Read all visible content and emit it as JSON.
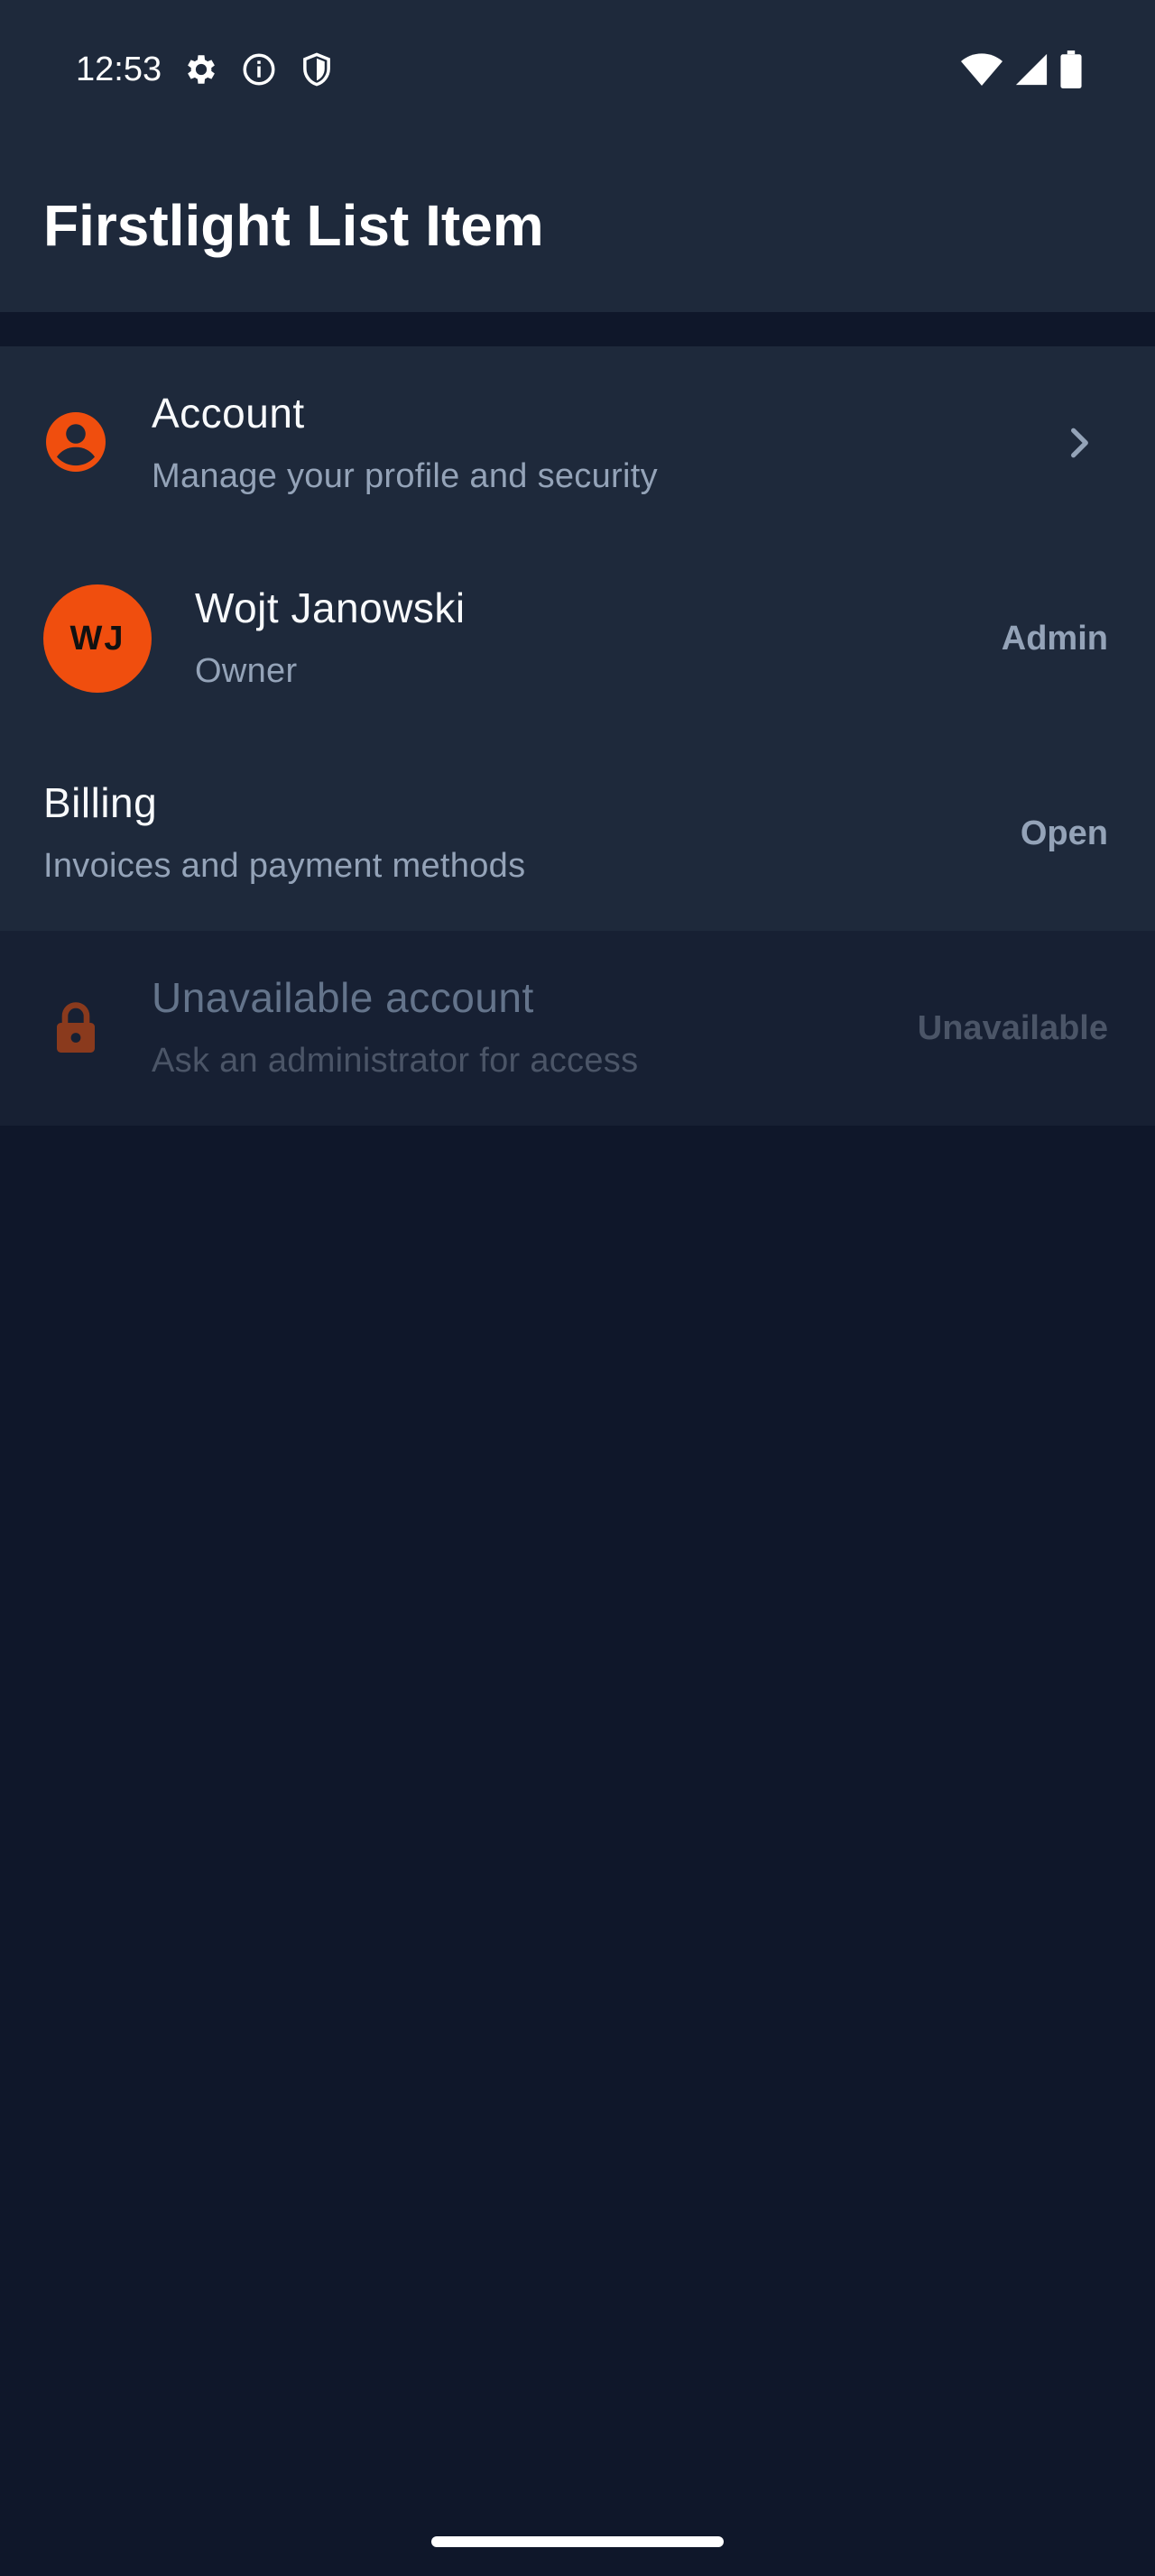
{
  "status_bar": {
    "time": "12:53",
    "left_icons": [
      "settings-icon",
      "info-icon",
      "shield-icon"
    ],
    "right_icons": [
      "wifi-icon",
      "signal-icon",
      "battery-icon"
    ]
  },
  "app_bar": {
    "title": "Firstlight List Item"
  },
  "list": {
    "account": {
      "title": "Account",
      "subtitle": "Manage your profile and security",
      "icon": "account-circle-icon",
      "trailing_icon": "chevron-right-icon"
    },
    "user": {
      "initials": "WJ",
      "name": "Wojt Janowski",
      "role": "Owner",
      "badge": "Admin"
    },
    "billing": {
      "title": "Billing",
      "subtitle": "Invoices and payment methods",
      "action": "Open"
    },
    "unavailable": {
      "title": "Unavailable account",
      "subtitle": "Ask an administrator for access",
      "icon": "lock-icon",
      "status": "Unavailable"
    }
  },
  "colors": {
    "background": "#0f172a",
    "surface": "#1e293b",
    "accent": "#f04e0e",
    "muted_text": "#94a3b8"
  }
}
